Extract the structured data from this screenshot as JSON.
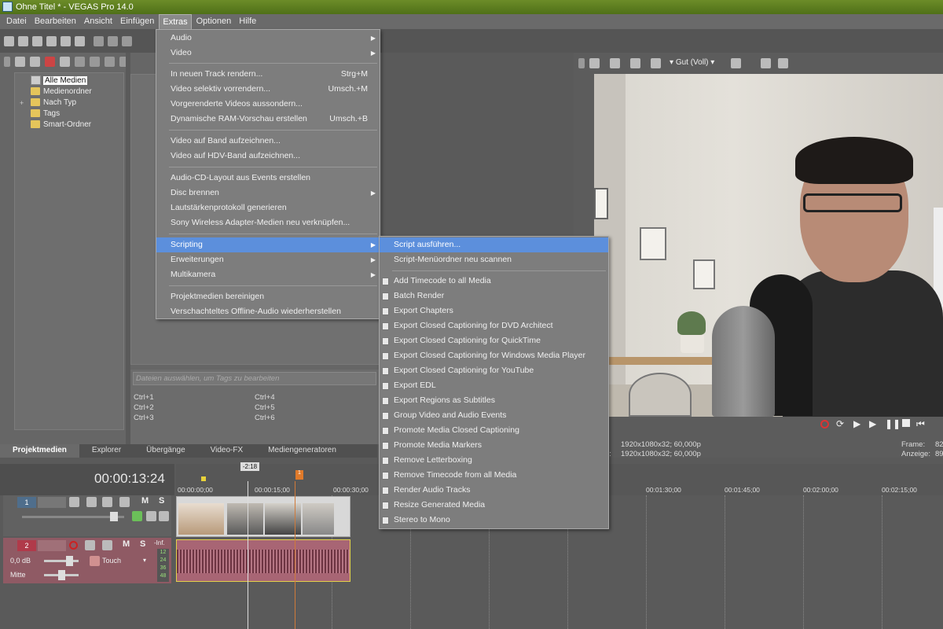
{
  "window": {
    "title": "Ohne Titel * - VEGAS Pro 14.0"
  },
  "menubar": [
    "Datei",
    "Bearbeiten",
    "Ansicht",
    "Einfügen",
    "Extras",
    "Optionen",
    "Hilfe"
  ],
  "explorer": {
    "tree": [
      "Alle Medien",
      "Medienordner",
      "Nach Typ",
      "Tags",
      "Smart-Ordner"
    ],
    "expander": "+",
    "tags_placeholder": "Dateien auswählen, um Tags zu bearbeiten",
    "shortcuts": [
      "Ctrl+1",
      "Ctrl+4",
      "Ctrl+2",
      "Ctrl+5",
      "Ctrl+3",
      "Ctrl+6"
    ]
  },
  "tabs": [
    "Projektmedien",
    "Explorer",
    "Übergänge",
    "Video-FX",
    "Mediengeneratoren"
  ],
  "extras_menu": [
    {
      "label": "Audio",
      "sub": true
    },
    {
      "label": "Video",
      "sub": true
    },
    {
      "label": "In neuen Track rendern...",
      "shortcut": "Strg+M"
    },
    {
      "label": "Video selektiv vorrendern...",
      "shortcut": "Umsch.+M"
    },
    {
      "label": "Vorgerenderte Videos aussondern..."
    },
    {
      "label": "Dynamische RAM-Vorschau erstellen",
      "shortcut": "Umsch.+B"
    },
    {
      "label": "Video auf Band aufzeichnen..."
    },
    {
      "label": "Video auf HDV-Band aufzeichnen..."
    },
    {
      "label": "Audio-CD-Layout aus Events erstellen"
    },
    {
      "label": "Disc brennen",
      "sub": true
    },
    {
      "label": "Lautstärkenprotokoll generieren"
    },
    {
      "label": "Sony Wireless Adapter-Medien neu verknüpfen..."
    },
    {
      "label": "Scripting",
      "sub": true,
      "highlight": true
    },
    {
      "label": "Erweiterungen",
      "sub": true
    },
    {
      "label": "Multikamera",
      "sub": true
    },
    {
      "label": "Projektmedien bereinigen"
    },
    {
      "label": "Verschachteltes Offline-Audio wiederherstellen"
    }
  ],
  "scripting_menu": {
    "top": [
      "Script ausführen...",
      "Script-Menüordner neu scannen"
    ],
    "scripts": [
      "Add Timecode to all Media",
      "Batch Render",
      "Export Chapters",
      "Export Closed Captioning for DVD Architect",
      "Export Closed Captioning for QuickTime",
      "Export Closed Captioning for Windows Media Player",
      "Export Closed Captioning for YouTube",
      "Export EDL",
      "Export Regions as Subtitles",
      "Group Video and Audio Events",
      "Promote Media Closed Captioning",
      "Promote Media Markers",
      "Remove Letterboxing",
      "Remove Timecode from all Media",
      "Render Audio Tracks",
      "Resize Generated Media",
      "Stereo to Mono"
    ]
  },
  "preview": {
    "quality": "Gut (Voll)",
    "project_info": "1920x1080x32; 60,000p",
    "preview_info": "1920x1080x32; 60,000p",
    "frame_label": "Frame:",
    "frame_value": "82",
    "display_label": "Anzeige:",
    "display_value": "89",
    "left_label_1": "t:",
    "left_label_2": "u:"
  },
  "timeline": {
    "timecode": "00:00:13:24",
    "ruler": [
      "00:00:00;00",
      "00:00:15;00",
      "00:00:30;00",
      "00:01:30;00",
      "00:01:45;00",
      "00:02:00;00",
      "00:02:15;00"
    ],
    "marker": "-2:18",
    "marker_flag": "1",
    "video_track": {
      "number": "1"
    },
    "audio_track": {
      "number": "2",
      "volume": "0,0 dB",
      "pan": "Mitte",
      "mode": "Touch",
      "level_label": "-Inf.",
      "meter": [
        "12",
        "24",
        "36",
        "48"
      ]
    },
    "mute_label": "M",
    "solo_label": "S"
  },
  "colors": {
    "highlight": "#5c8fdc",
    "title_bar": "#5a7d20",
    "audio_track": "#8f5a64",
    "video_track": "#4f6e8c"
  }
}
